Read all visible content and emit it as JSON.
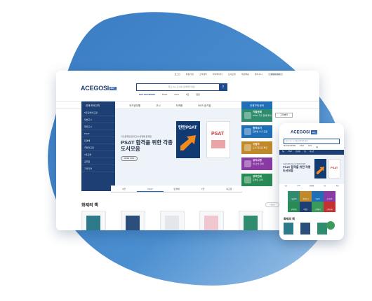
{
  "colors": {
    "navy": "#1d3f73",
    "accent": "#1f6fb8",
    "orange": "#f28a1e",
    "blob": "#2f6fb6"
  },
  "desktop": {
    "util_links": [
      "로그인",
      "회원가입",
      "고객센터",
      "마이페이지",
      "도서교환",
      "주문배송",
      "장바구니"
    ],
    "util_button": "ENGLISH",
    "logo": "ACEGOSI",
    "logo_tag": "에이스",
    "search_placeholder": "찾으시는 도서를 검색해주세요!",
    "search_icon": "search-icon",
    "hot_keyword_label": "HOT KEYWORD",
    "hot_keywords": [
      "PSAT",
      "NCS",
      "9급",
      "경찰"
    ],
    "nav_category": "전체 카테고리",
    "nav_items": [
      "국가공무원",
      "고시",
      "자격증",
      "NCS·공기업"
    ],
    "nav_employee": "단체구매 문의",
    "side_menu": [
      "5급공채/외교관",
      "입법고시",
      "행정고시",
      "PSAT",
      "민경채",
      "국립외교원",
      "7급공채",
      "공무원",
      "기타자격"
    ],
    "hero_sub": "기출문제집/모의고사/유형별 문제집",
    "hero_title": "PSAT 합격을 위한 각종 도서모음",
    "hero_more": "MORE VIEW",
    "book1_title": "탄탄PSAT",
    "book2_title": "PSAT",
    "tabs": [
      "5급",
      "PSAT",
      "민경채",
      "7급",
      "외교관"
    ],
    "tab_active_index": 1,
    "cards": [
      {
        "label": "기출문제",
        "desc": "PSAT 기출 문제 풀이",
        "color": "#2f8c6e"
      },
      {
        "label": "합격수기",
        "desc": "합격생 수기 모음",
        "color": "#1f6fb8"
      },
      {
        "label": "오탈자",
        "desc": "도서 정오표 확인",
        "color": "#c08a2a"
      },
      {
        "label": "공지사항",
        "desc": "새 소식 안내",
        "color": "#8a3aa5"
      },
      {
        "label": "강의안내",
        "desc": "온라인 강의",
        "color": "#2a8a55"
      }
    ],
    "card_cs": "고객센터",
    "section_title": "화제의 책",
    "section_more": "더보기"
  },
  "mobile": {
    "logo": "ACEGOSI",
    "logo_tag": "에이스",
    "search_placeholder": "찾으시는 도서를 검색해주세요!",
    "keywords": [
      "HOT KEYWORD",
      "PSAT",
      "NCS",
      "9급"
    ],
    "nav": [
      "5급",
      "PSAT",
      "민경채",
      "7급",
      "외교관"
    ],
    "hero_sub": "기출문제집/모의고사/유형별 문제집",
    "hero_title": "PSAT 합격을 위한 각종 도서모음",
    "book2_title": "PSAT",
    "tabs": [
      "5급",
      "PSAT",
      "민경채",
      "7급",
      "외교"
    ],
    "grid": [
      {
        "label": "기출문제",
        "color": "#2f8c6e"
      },
      {
        "label": "합격수기",
        "color": "#c08a2a"
      },
      {
        "label": "오탈자",
        "color": "#1f6fb8"
      },
      {
        "label": "공지사항",
        "color": "#8a3aa5"
      },
      {
        "label": "강의안내",
        "color": "#2a8a55"
      },
      {
        "label": "이벤트",
        "color": "#1d3f73"
      },
      {
        "label": "고객센터",
        "color": "#3a9a5b"
      },
      {
        "label": "단체구매",
        "color": "#c43131"
      }
    ],
    "section_title": "화제의 책"
  }
}
